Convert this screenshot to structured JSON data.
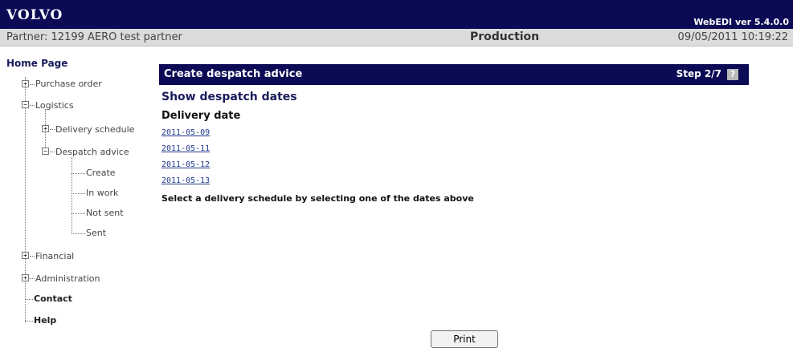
{
  "header": {
    "logo": "VOLVO",
    "version": "WebEDI ver 5.4.0.0",
    "partner": "Partner: 12199 AERO test partner",
    "environment": "Production",
    "datetime": "09/05/2011 10:19:22"
  },
  "sidebar": {
    "home": "Home Page",
    "purchase_order": "Purchase order",
    "logistics": "Logistics",
    "delivery_schedule": "Delivery schedule",
    "despatch_advice": "Despatch advice",
    "create": "Create",
    "in_work": "In work",
    "not_sent": "Not sent",
    "sent": "Sent",
    "financial": "Financial",
    "administration": "Administration",
    "contact": "Contact",
    "help": "Help",
    "toggle_plus": "+",
    "toggle_minus": "−"
  },
  "main": {
    "title": "Create despatch advice",
    "step": "Step 2/7",
    "help_icon": "?",
    "subtitle": "Show despatch dates",
    "column_header": "Delivery date",
    "dates": [
      "2011-05-09",
      "2011-05-11",
      "2011-05-12",
      "2011-05-13"
    ],
    "instruction": "Select a delivery schedule by selecting one of the dates above",
    "print_label": "Print"
  },
  "colors": {
    "header_bg": "#0b0a55",
    "info_bg": "#dcdcdc",
    "link": "#223a8c"
  }
}
